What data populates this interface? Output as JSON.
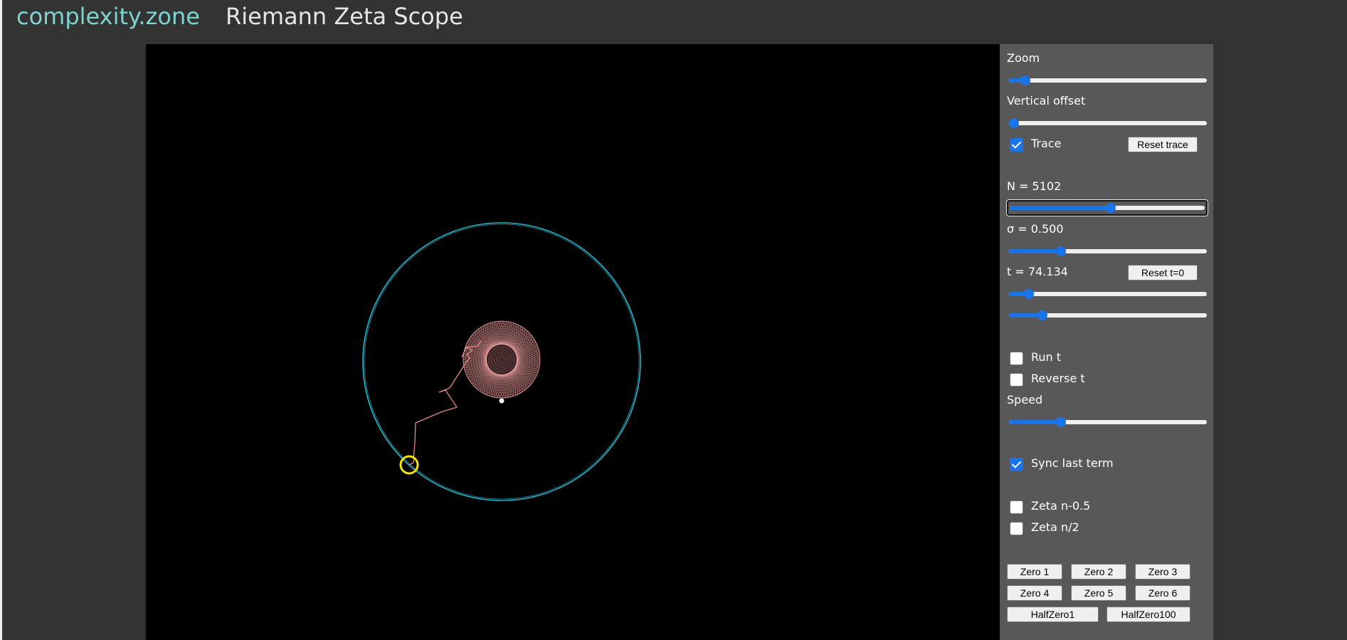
{
  "header": {
    "brand": "complexity.zone",
    "title": "Riemann Zeta Scope"
  },
  "panel": {
    "zoom": {
      "label": "Zoom",
      "value": 0.06
    },
    "vertical_offset": {
      "label": "Vertical offset",
      "value": 0.0
    },
    "trace": {
      "label": "Trace",
      "checked": true,
      "reset_button": "Reset trace"
    },
    "n": {
      "label": "N = 5102",
      "value": 0.52
    },
    "sigma": {
      "label": "σ = 0.500",
      "value": 0.25
    },
    "t": {
      "label": "t = 74.134",
      "reset_button": "Reset t=0",
      "coarse_value": 0.08,
      "fine_value": 0.15
    },
    "run_t": {
      "label": "Run t",
      "checked": false
    },
    "reverse_t": {
      "label": "Reverse t",
      "checked": false
    },
    "speed": {
      "label": "Speed",
      "value": 0.25
    },
    "sync_last_term": {
      "label": "Sync last term",
      "checked": true
    },
    "zeta_n_half_offset": {
      "label": "Zeta n-0.5",
      "checked": false
    },
    "zeta_n_over_2": {
      "label": "Zeta n/2",
      "checked": false
    },
    "zero_buttons": [
      "Zero 1",
      "Zero 2",
      "Zero 3",
      "Zero 4",
      "Zero 5",
      "Zero 6"
    ],
    "half_zero_buttons": [
      "HalfZero1",
      "HalfZero100"
    ]
  },
  "colors": {
    "background": "#333333",
    "panel": "#585858",
    "canvas": "#000000",
    "brand": "#7fd3cf",
    "slider_accent": "#1a73e8",
    "orbit_circle": "#2bb3c8",
    "spiral": "#f4a6a6",
    "path": "#e88a8a",
    "marker": "#f5e600"
  }
}
